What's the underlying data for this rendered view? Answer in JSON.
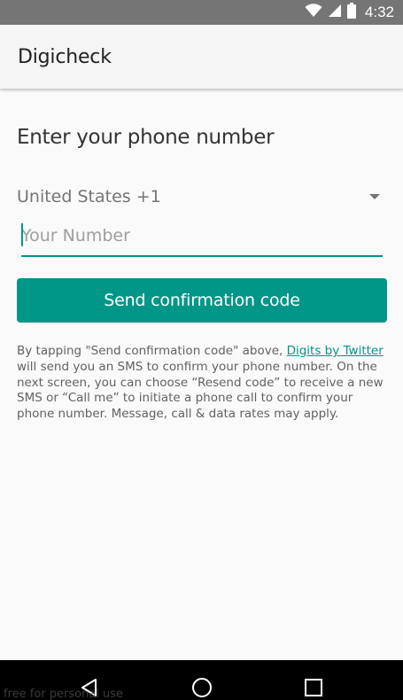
{
  "status_bar": {
    "time": "4:32",
    "icons": [
      "wifi-icon",
      "cellular-signal-icon",
      "battery-icon"
    ]
  },
  "app_bar": {
    "title": "Digicheck"
  },
  "form": {
    "heading": "Enter your phone number",
    "country": "United States +1",
    "phone_placeholder": "Your Number",
    "phone_value": "",
    "send_button_label": "Send confirmation code"
  },
  "disclaimer": {
    "text_before": "By tapping \"Send confirmation code\" above, ",
    "link_text": "Digits by Twitter",
    "text_after": " will send you an SMS to confirm your phone number. On the next screen, you can choose “Resend code” to receive a new SMS or “Call me” to initiate a phone call to confirm your phone number. Message, call & data rates may apply."
  },
  "nav_bar": {
    "buttons": [
      "back-icon",
      "home-icon",
      "recents-icon"
    ]
  },
  "watermark": "free for personal use",
  "colors": {
    "accent": "#009688",
    "status_bar": "#757575",
    "app_bar": "#f5f5f5",
    "nav_bar": "#000000"
  }
}
